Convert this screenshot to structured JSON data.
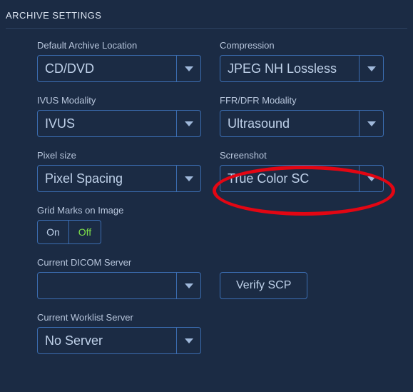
{
  "section_title": "ARCHIVE SETTINGS",
  "fields": {
    "default_archive_location": {
      "label": "Default Archive Location",
      "value": "CD/DVD"
    },
    "compression": {
      "label": "Compression",
      "value": "JPEG NH Lossless"
    },
    "ivus_modality": {
      "label": "IVUS Modality",
      "value": "IVUS"
    },
    "ffr_dfr_modality": {
      "label": "FFR/DFR Modality",
      "value": "Ultrasound"
    },
    "pixel_size": {
      "label": "Pixel size",
      "value": "Pixel Spacing"
    },
    "screenshot": {
      "label": "Screenshot",
      "value": "True Color SC"
    },
    "grid_marks": {
      "label": "Grid Marks on Image",
      "on_label": "On",
      "off_label": "Off",
      "value": "Off"
    },
    "current_dicom_server": {
      "label": "Current DICOM Server",
      "value": ""
    },
    "current_worklist_server": {
      "label": "Current Worklist Server",
      "value": "No Server"
    }
  },
  "buttons": {
    "verify_scp": "Verify SCP"
  },
  "annotation": {
    "target": "dropdown-screenshot",
    "color": "#e30613"
  }
}
